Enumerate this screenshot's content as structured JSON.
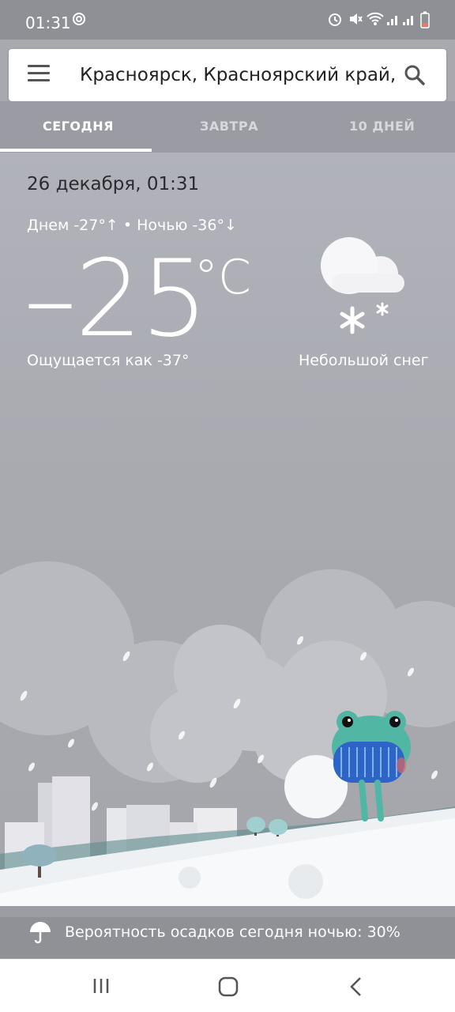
{
  "status": {
    "time": "01:31",
    "icons": [
      "sync-icon",
      "alarm-icon",
      "mute-icon",
      "wifi-icon",
      "signal-icon",
      "signal-icon",
      "battery-low-icon"
    ]
  },
  "search": {
    "query": "Красноярск, Красноярский край,",
    "icons": [
      "menu-icon",
      "search-icon"
    ]
  },
  "tabs": [
    "СЕГОДНЯ",
    "ЗАВТРА",
    "10 ДНЕЙ"
  ],
  "weather": {
    "datetime": "26 декабря, 01:31",
    "hilo": "Днем -27°↑ • Ночью -36°↓",
    "temperature": "–25",
    "unit": "°C",
    "feels_like": "Ощущается как -37°",
    "condition": "Небольшой снег",
    "condition_icon": "cloud-snow-icon"
  },
  "precipitation": {
    "text": "Вероятность осадков сегодня ночью: 30%",
    "icon": "umbrella-icon"
  },
  "navbar": {
    "icons": [
      "recent-apps-icon",
      "home-icon",
      "back-icon"
    ]
  },
  "colors": {
    "sky": "#a9aab0",
    "tab_bar": "#9b9ca3",
    "accent_white": "#ffffff"
  }
}
